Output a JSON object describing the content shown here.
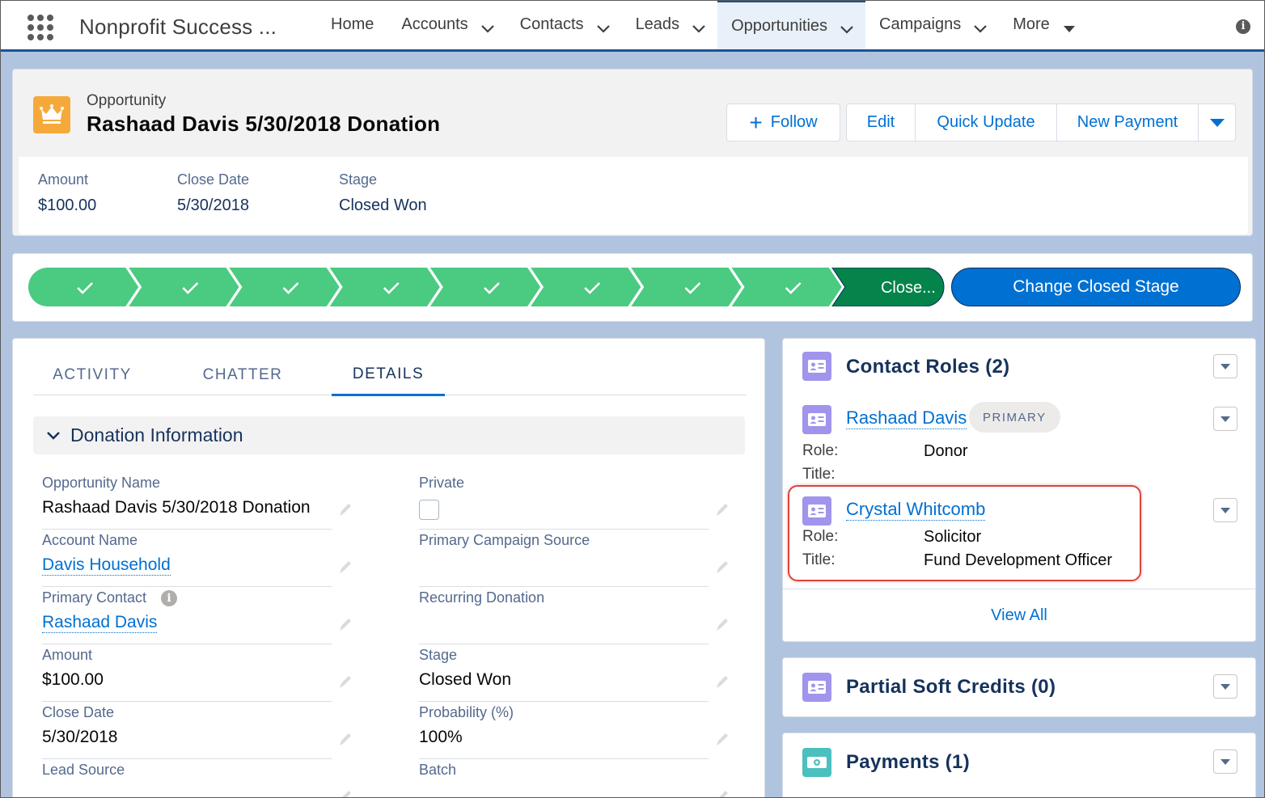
{
  "app": {
    "name": "Nonprofit Success ..."
  },
  "nav": {
    "items": [
      {
        "label": "Home",
        "dropdown": false,
        "active": false
      },
      {
        "label": "Accounts",
        "dropdown": true,
        "active": false
      },
      {
        "label": "Contacts",
        "dropdown": true,
        "active": false
      },
      {
        "label": "Leads",
        "dropdown": true,
        "active": false
      },
      {
        "label": "Opportunities",
        "dropdown": true,
        "active": true
      },
      {
        "label": "Campaigns",
        "dropdown": true,
        "active": false
      },
      {
        "label": "More",
        "dropdown": true,
        "active": false
      }
    ],
    "info_icon": "i"
  },
  "header": {
    "object_type": "Opportunity",
    "title": "Rashaad Davis 5/30/2018 Donation",
    "buttons": {
      "follow": "Follow",
      "edit": "Edit",
      "quick_update": "Quick Update",
      "new_payment": "New Payment"
    },
    "highlights": [
      {
        "label": "Amount",
        "value": "$100.00"
      },
      {
        "label": "Close Date",
        "value": "5/30/2018"
      },
      {
        "label": "Stage",
        "value": "Closed Won"
      }
    ]
  },
  "path": {
    "completed_steps": 8,
    "current_label": "Close...",
    "change_button": "Change Closed Stage",
    "colors": {
      "complete": "#4bca81",
      "current": "#04844b"
    }
  },
  "tabs": [
    {
      "label": "ACTIVITY",
      "active": false
    },
    {
      "label": "CHATTER",
      "active": false
    },
    {
      "label": "DETAILS",
      "active": true
    }
  ],
  "details": {
    "section_title": "Donation Information",
    "fields": {
      "opportunity_name": {
        "label": "Opportunity Name",
        "value": "Rashaad Davis 5/30/2018 Donation"
      },
      "private": {
        "label": "Private"
      },
      "account_name": {
        "label": "Account Name",
        "value": "Davis Household"
      },
      "primary_campaign_source": {
        "label": "Primary Campaign Source",
        "value": ""
      },
      "primary_contact": {
        "label": "Primary Contact",
        "value": "Rashaad Davis"
      },
      "recurring_donation": {
        "label": "Recurring Donation",
        "value": ""
      },
      "amount": {
        "label": "Amount",
        "value": "$100.00"
      },
      "stage": {
        "label": "Stage",
        "value": "Closed Won"
      },
      "close_date": {
        "label": "Close Date",
        "value": "5/30/2018"
      },
      "probability": {
        "label": "Probability (%)",
        "value": "100%"
      },
      "lead_source": {
        "label": "Lead Source",
        "value": ""
      },
      "batch": {
        "label": "Batch",
        "value": ""
      }
    }
  },
  "contact_roles": {
    "title": "Contact Roles (2)",
    "role_label": "Role:",
    "title_label": "Title:",
    "items": [
      {
        "name": "Rashaad Davis",
        "badge": "PRIMARY",
        "role": "Donor",
        "title": ""
      },
      {
        "name": "Crystal Whitcomb",
        "badge": "",
        "role": "Solicitor",
        "title": "Fund Development Officer"
      }
    ],
    "view_all": "View All"
  },
  "partial_soft_credits": {
    "title": "Partial Soft Credits (0)"
  },
  "payments": {
    "title": "Payments (1)"
  },
  "colors": {
    "brand": "#0070d2",
    "nav_border": "#1b5297",
    "highlight_box": "#d9443f",
    "opportunity_icon": "#f6a93b",
    "contact_icon": "#a094ed",
    "payment_icon": "#4bc0bf"
  }
}
